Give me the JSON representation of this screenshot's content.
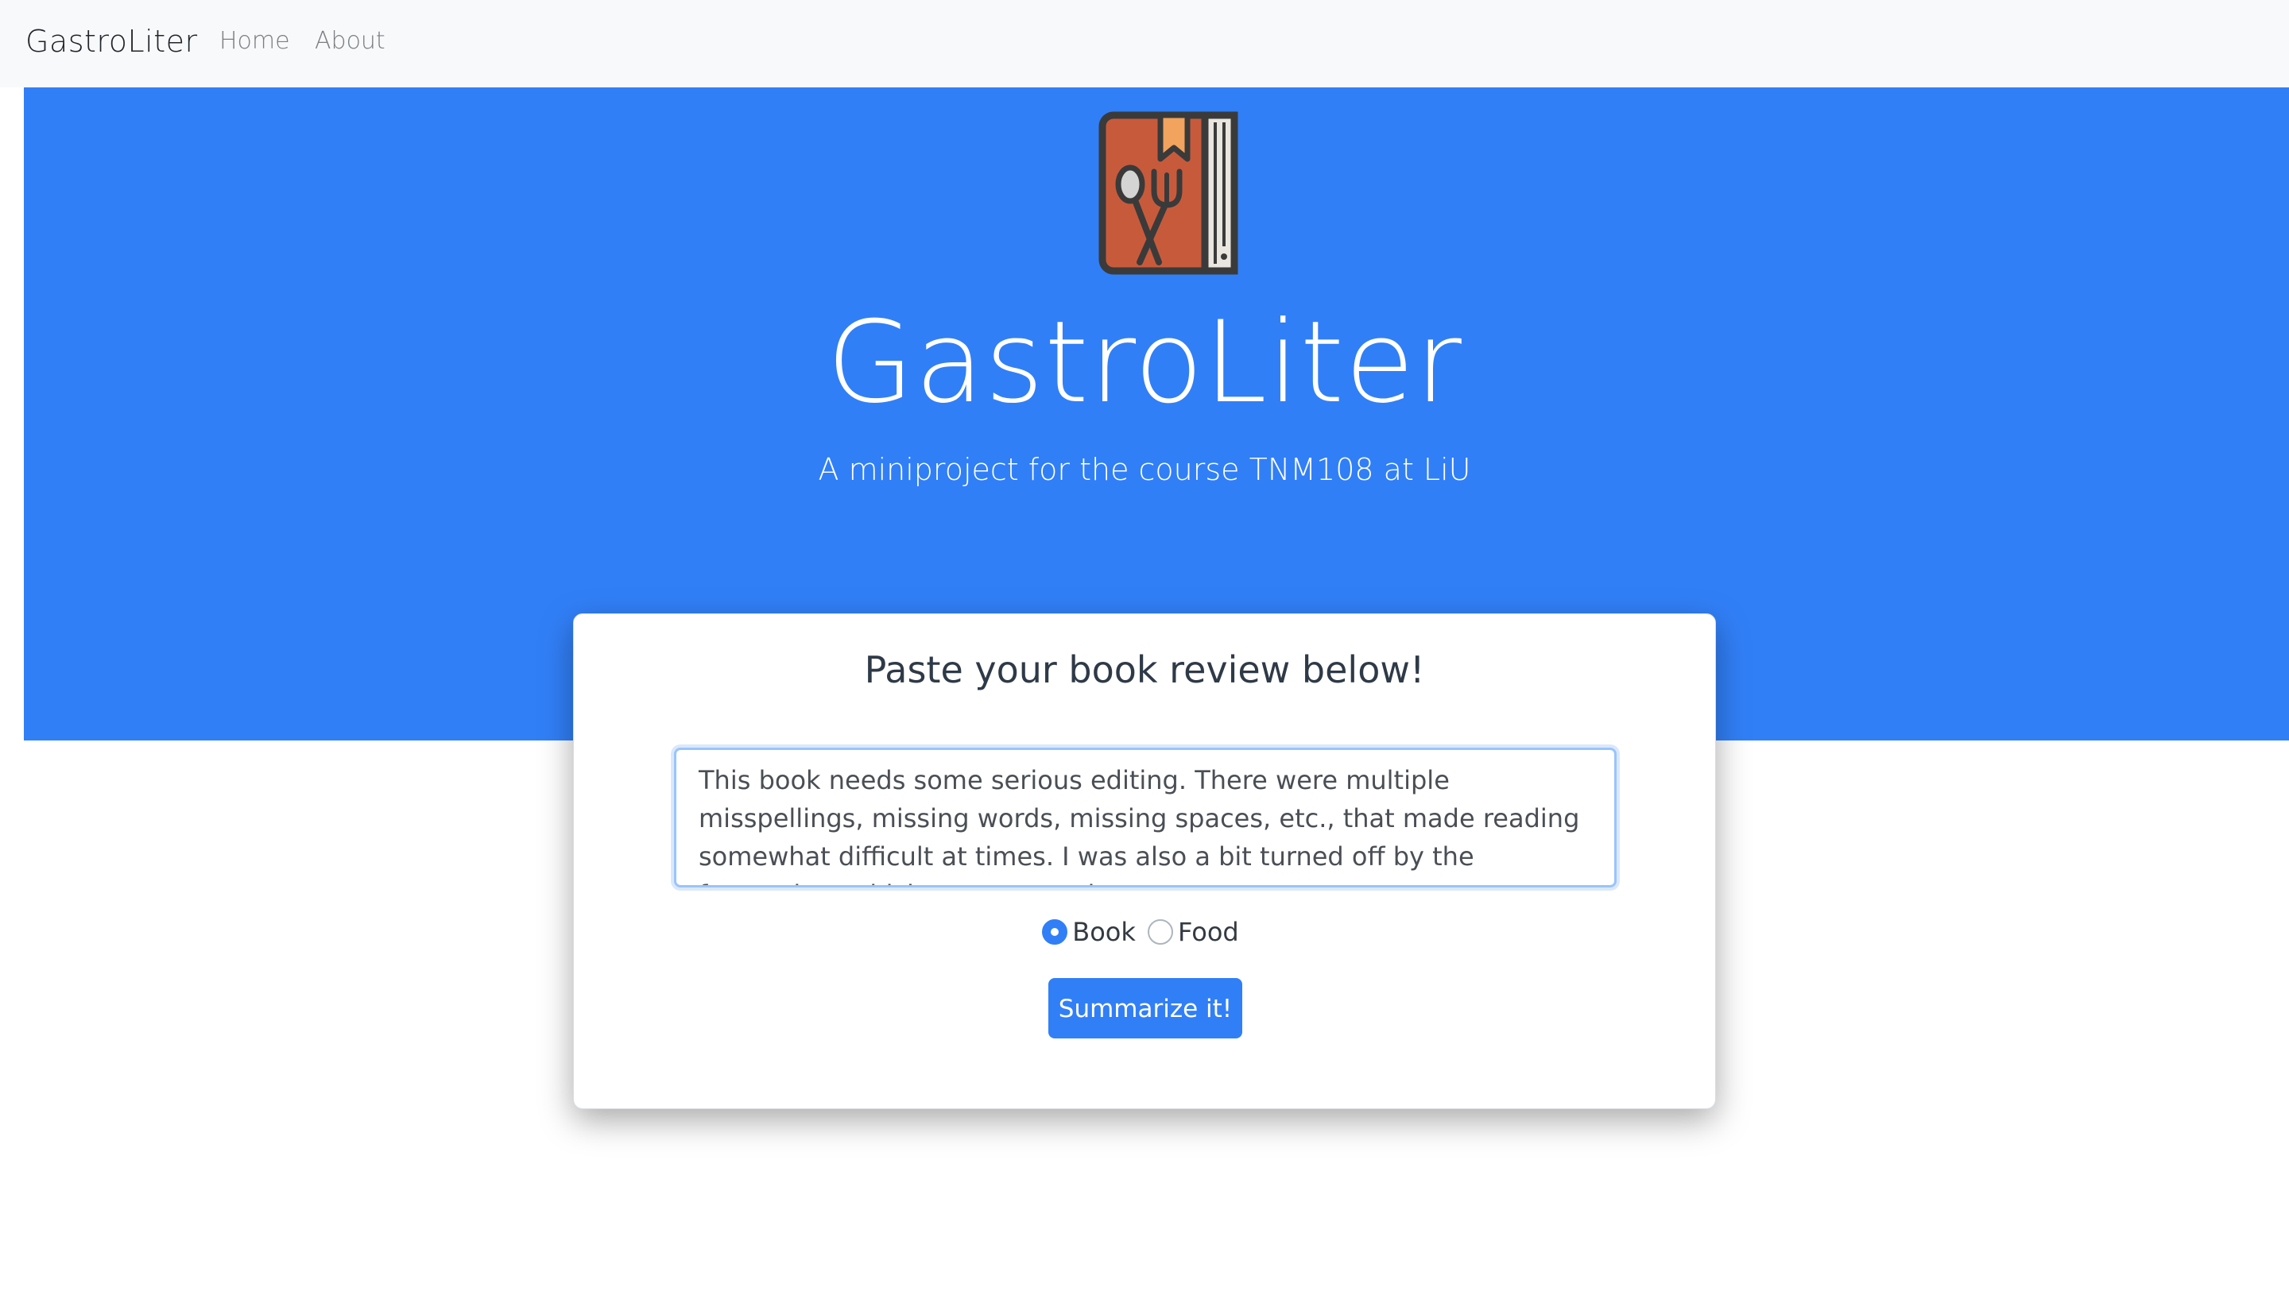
{
  "navbar": {
    "brand": "GastroLiter",
    "links": [
      {
        "label": "Home"
      },
      {
        "label": "About"
      }
    ]
  },
  "hero": {
    "logo_icon": "recipe-book-icon",
    "title": "GastroLiter",
    "subtitle": "A miniproject for the course TNM108 at LiU"
  },
  "form": {
    "heading": "Paste your book review below!",
    "review_text": "This book needs some serious editing. There were multiple misspellings, missing words, missing spaces, etc., that made reading somewhat difficult at times. I was also a bit turned off by the formatting, which put a space between",
    "category_options": [
      {
        "label": "Book",
        "checked": true
      },
      {
        "label": "Food",
        "checked": false
      }
    ],
    "submit_label": "Summarize it!"
  },
  "colors": {
    "accent": "#317ff7",
    "navbar_bg": "#f8f9fa",
    "book_cover": "#c85a3c",
    "bookmark": "#f2a35e"
  }
}
